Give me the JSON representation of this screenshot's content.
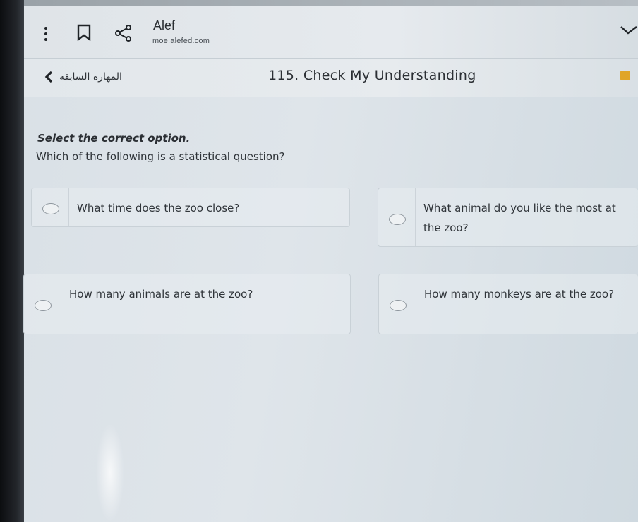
{
  "app": {
    "title": "Alef",
    "url": "moe.alefed.com"
  },
  "icons": {
    "menu": "vertical-dots-icon",
    "bookmark": "bookmark-icon",
    "share": "share-icon",
    "chevron": "chevron-down-icon",
    "back": "chevron-left-icon"
  },
  "nav": {
    "back_label": "المهارة السابقة",
    "lesson_title": "115. Check My Understanding"
  },
  "quiz": {
    "instruction": "Select the correct option.",
    "question": "Which of the following is a statistical question?",
    "options": [
      {
        "label": "What time does the zoo close?"
      },
      {
        "label": "What animal do you like the most at the zoo?"
      },
      {
        "label": "How many animals are at the zoo?"
      },
      {
        "label": "How many monkeys are at the zoo?"
      }
    ]
  },
  "colors": {
    "flag_accent": "#e0a528"
  }
}
